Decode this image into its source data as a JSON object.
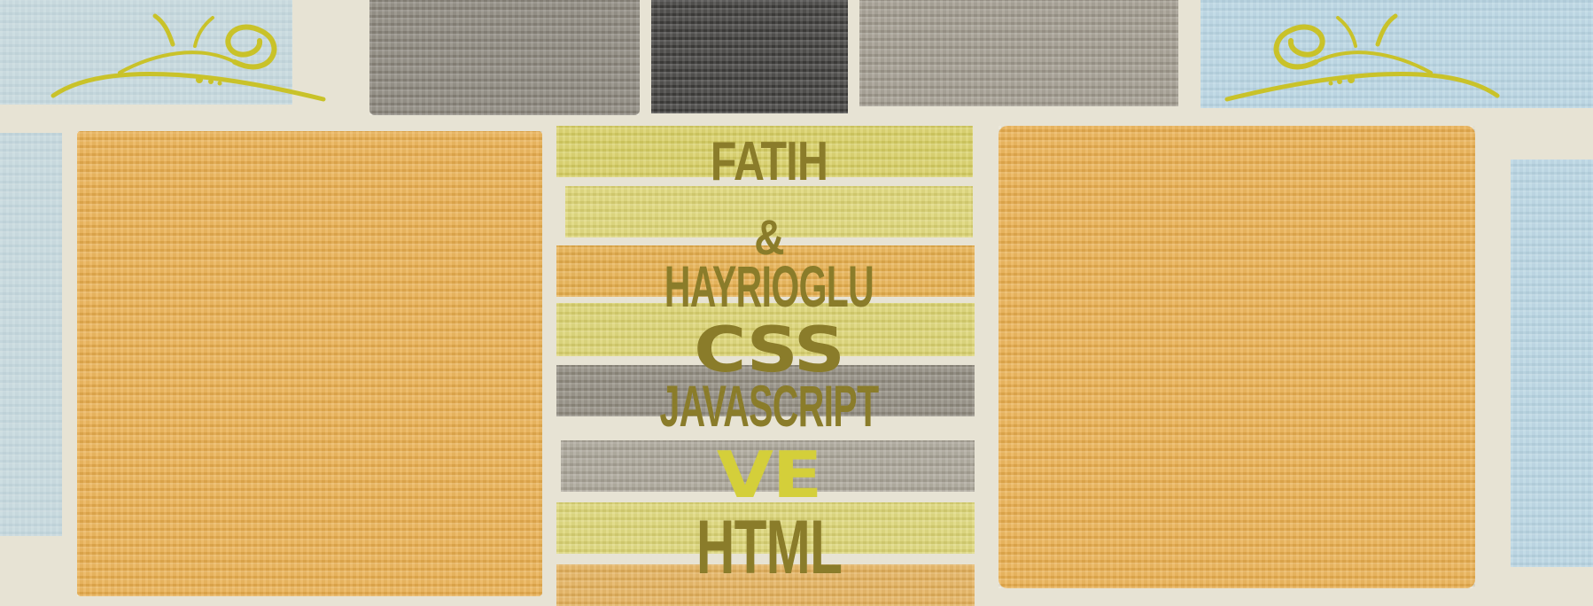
{
  "artwork": {
    "words": {
      "line1": "FATIH",
      "line2": "&",
      "line3": "HAYRIOGLU",
      "line4": "CSS",
      "line5": "JAVASCRIPT",
      "line6": "VE",
      "line7": "HTML"
    },
    "colors": {
      "background": "#e7e3d4",
      "orange": "#e9ae4e",
      "blue": "#a9d2ea",
      "dark_gray": "#3e3d3b",
      "gray": "#8a857b",
      "olive_text": "#8a7c2a",
      "accent_yellow": "#d4cf3a",
      "ornament_yellow": "#c9c229"
    },
    "ornaments": [
      "left-flourish-ornament",
      "right-flourish-ornament"
    ]
  }
}
